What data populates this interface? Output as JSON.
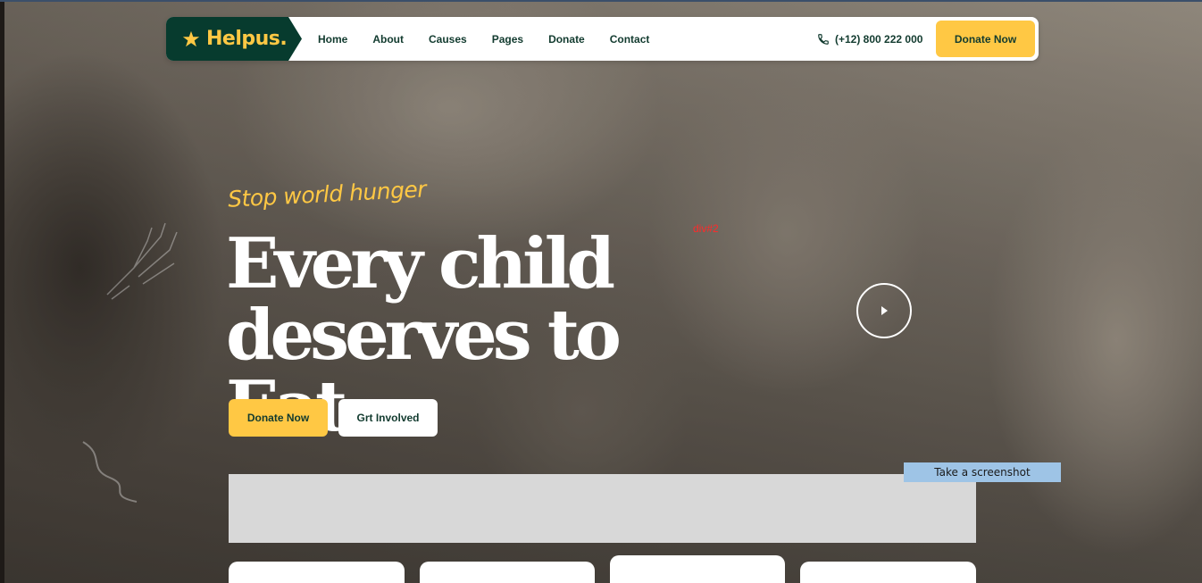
{
  "brand": {
    "name": "Helpus.",
    "logo_icon": "star-hand-icon",
    "primary": "#073b2e",
    "accent": "#ffc844"
  },
  "nav": {
    "links": [
      "Home",
      "About",
      "Causes",
      "Pages",
      "Donate",
      "Contact"
    ],
    "phone": "(+12) 800 222 000",
    "cta": "Donate Now"
  },
  "hero": {
    "tagline": "Stop world hunger",
    "headline_line1": "Every child",
    "headline_line2": "deserves to Eat.",
    "primary_button": "Donate Now",
    "secondary_button": "Grt Involved",
    "play_icon": "play-icon"
  },
  "overlay": {
    "debug_label": "div#2",
    "screenshot_button": "Take a screenshot"
  }
}
